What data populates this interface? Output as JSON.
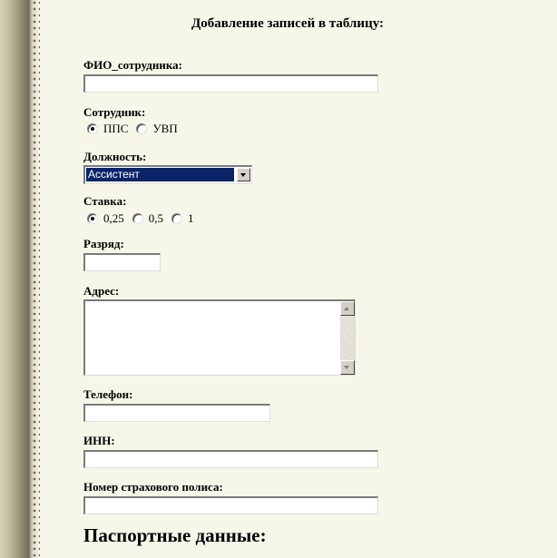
{
  "form": {
    "heading": "Добавление записей в таблицу:",
    "fio": {
      "label": "ФИО_сотрудника:",
      "value": ""
    },
    "employee": {
      "label": "Сотрудник:",
      "options": [
        "ППС",
        "УВП"
      ],
      "selected": "ППС"
    },
    "position": {
      "label": "Должность:",
      "selected_value": "Ассистент"
    },
    "rate": {
      "label": "Ставка:",
      "options": [
        "0,25",
        "0,5",
        "1"
      ],
      "selected": "0,25"
    },
    "grade": {
      "label": "Разряд:",
      "value": ""
    },
    "address": {
      "label": "Адрес:",
      "value": ""
    },
    "phone": {
      "label": "Телефон:",
      "value": ""
    },
    "inn": {
      "label": "ИНН:",
      "value": ""
    },
    "insurance": {
      "label": "Номер страхового полиса:",
      "value": ""
    },
    "passport_heading": "Паспортные данные:"
  },
  "colors": {
    "page_background": "#f7f7e9",
    "selection_highlight": "#0a246a",
    "control_face": "#d4d0c8"
  }
}
